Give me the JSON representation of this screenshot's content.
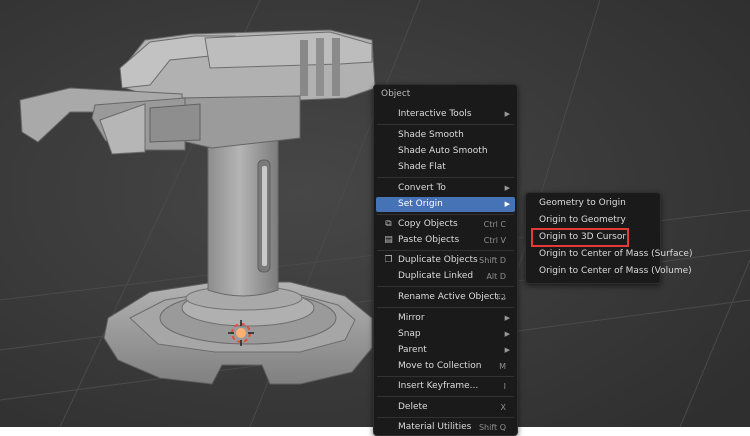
{
  "context_menu": {
    "title": "Object",
    "items": [
      {
        "label": "Interactive Tools",
        "shortcut": "",
        "submenu": true
      },
      {
        "label": "Shade Smooth",
        "shortcut": "",
        "submenu": false
      },
      {
        "label": "Shade Auto Smooth",
        "shortcut": "",
        "submenu": false
      },
      {
        "label": "Shade Flat",
        "shortcut": "",
        "submenu": false
      },
      {
        "label": "Convert To",
        "shortcut": "",
        "submenu": true
      },
      {
        "label": "Set Origin",
        "shortcut": "",
        "submenu": true,
        "active": true
      },
      {
        "label": "Copy Objects",
        "shortcut": "Ctrl C",
        "submenu": false,
        "icon": "copy-icon"
      },
      {
        "label": "Paste Objects",
        "shortcut": "Ctrl V",
        "submenu": false,
        "icon": "paste-icon"
      },
      {
        "label": "Duplicate Objects",
        "shortcut": "Shift D",
        "submenu": false,
        "icon": "duplicate-icon"
      },
      {
        "label": "Duplicate Linked",
        "shortcut": "Alt D",
        "submenu": false
      },
      {
        "label": "Rename Active Object...",
        "shortcut": "F2",
        "submenu": false
      },
      {
        "label": "Mirror",
        "shortcut": "",
        "submenu": true
      },
      {
        "label": "Snap",
        "shortcut": "",
        "submenu": true
      },
      {
        "label": "Parent",
        "shortcut": "",
        "submenu": true
      },
      {
        "label": "Move to Collection",
        "shortcut": "M",
        "submenu": false
      },
      {
        "label": "Insert Keyframe...",
        "shortcut": "I",
        "submenu": false
      },
      {
        "label": "Delete",
        "shortcut": "X",
        "submenu": false
      },
      {
        "label": "Material Utilities",
        "shortcut": "Shift Q",
        "submenu": false
      }
    ]
  },
  "set_origin_submenu": {
    "items": [
      {
        "label": "Geometry to Origin"
      },
      {
        "label": "Origin to Geometry"
      },
      {
        "label": "Origin to 3D Cursor",
        "highlighted": true
      },
      {
        "label": "Origin to Center of Mass (Surface)"
      },
      {
        "label": "Origin to Center of Mass (Volume)"
      }
    ]
  },
  "colors": {
    "viewport_bg": "#3a3a3a",
    "menu_bg": "#1a1a1a",
    "active_item": "#4672b6",
    "highlight_box": "#e53935",
    "model_gray": "#9e9e9e"
  }
}
